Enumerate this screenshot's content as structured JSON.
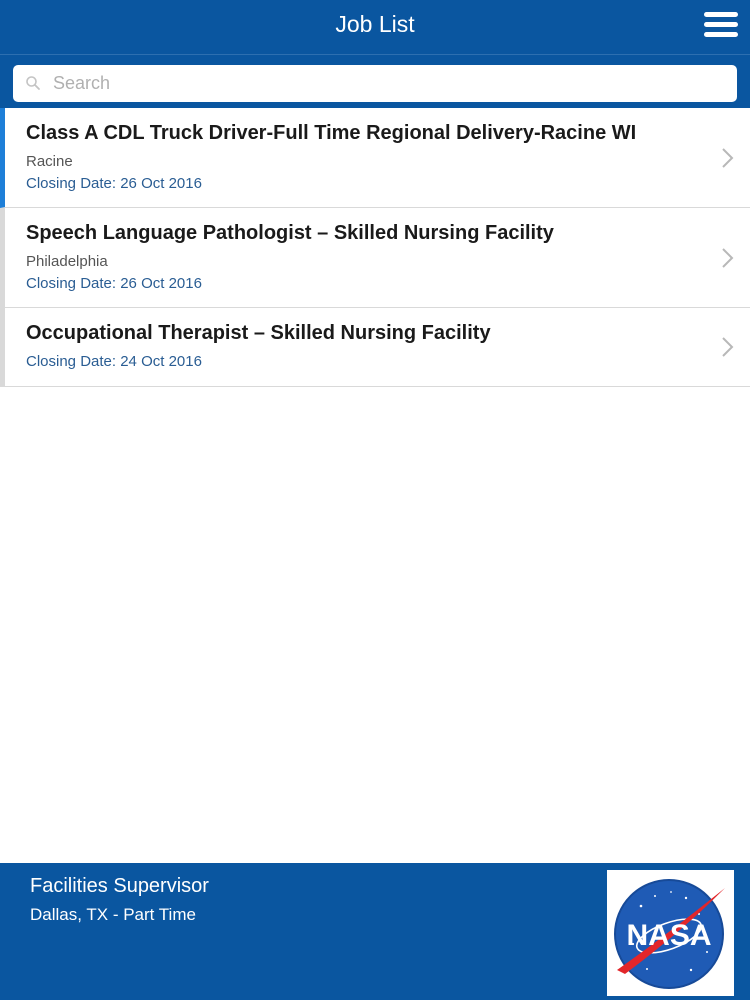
{
  "header": {
    "title": "Job List",
    "menu_icon": "hamburger-menu-icon"
  },
  "search": {
    "placeholder": "Search",
    "value": "",
    "icon": "search-icon"
  },
  "jobs": [
    {
      "title": "Class A CDL Truck Driver-Full Time Regional Delivery-Racine WI",
      "location": "Racine",
      "closing": "Closing Date: 26 Oct 2016",
      "selected": true
    },
    {
      "title": "Speech Language Pathologist – Skilled Nursing Facility",
      "location": "Philadelphia",
      "closing": "Closing Date: 26 Oct 2016",
      "selected": false
    },
    {
      "title": "Occupational Therapist – Skilled Nursing Facility",
      "closing": "Closing Date: 24 Oct 2016",
      "selected": false
    }
  ],
  "footer": {
    "title": "Facilities Supervisor",
    "subtitle": "Dallas, TX - Part Time",
    "logo_text": "NASA"
  },
  "colors": {
    "brand_blue": "#0a56a0",
    "selected_accent": "#1e7fd8",
    "closing_text": "#2a5d93"
  }
}
